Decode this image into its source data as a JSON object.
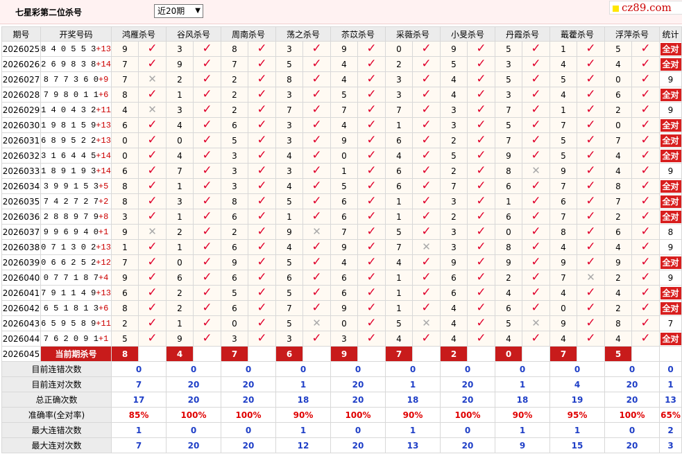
{
  "header": {
    "title": "七星彩第二位杀号",
    "period_selected": "近20期",
    "logo_text": "cz89.com"
  },
  "columns": {
    "issue": "期号",
    "draw": "开奖号码",
    "experts": [
      "鸿雁杀号",
      "谷风杀号",
      "周南杀号",
      "荡之杀号",
      "苶苡杀号",
      "采薇杀号",
      "小旻杀号",
      "丹霞杀号",
      "蕺藿杀号",
      "浮萍杀号"
    ],
    "stat": "统计"
  },
  "rows": [
    {
      "issue": "2026025",
      "main": "840553",
      "special": "+13",
      "kills": [
        9,
        3,
        8,
        3,
        9,
        0,
        9,
        5,
        1,
        5
      ],
      "results": [
        1,
        1,
        1,
        1,
        1,
        1,
        1,
        1,
        1,
        1
      ],
      "stat": "全对"
    },
    {
      "issue": "2026026",
      "main": "269838",
      "special": "+14",
      "kills": [
        7,
        9,
        7,
        5,
        4,
        2,
        5,
        3,
        4,
        4
      ],
      "results": [
        1,
        1,
        1,
        1,
        1,
        1,
        1,
        1,
        1,
        1
      ],
      "stat": "全对"
    },
    {
      "issue": "2026027",
      "main": "877360",
      "special": "+9",
      "kills": [
        7,
        2,
        2,
        8,
        4,
        3,
        4,
        5,
        5,
        0
      ],
      "results": [
        0,
        1,
        1,
        1,
        1,
        1,
        1,
        1,
        1,
        1
      ],
      "stat": "9"
    },
    {
      "issue": "2026028",
      "main": "798011",
      "special": "+6",
      "kills": [
        8,
        1,
        2,
        3,
        5,
        3,
        4,
        3,
        4,
        6
      ],
      "results": [
        1,
        1,
        1,
        1,
        1,
        1,
        1,
        1,
        1,
        1
      ],
      "stat": "全对"
    },
    {
      "issue": "2026029",
      "main": "140432",
      "special": "+11",
      "kills": [
        4,
        3,
        2,
        7,
        7,
        7,
        3,
        7,
        1,
        2
      ],
      "results": [
        0,
        1,
        1,
        1,
        1,
        1,
        1,
        1,
        1,
        1
      ],
      "stat": "9"
    },
    {
      "issue": "2026030",
      "main": "198159",
      "special": "+13",
      "kills": [
        6,
        4,
        6,
        3,
        4,
        1,
        3,
        5,
        7,
        0
      ],
      "results": [
        1,
        1,
        1,
        1,
        1,
        1,
        1,
        1,
        1,
        1
      ],
      "stat": "全对"
    },
    {
      "issue": "2026031",
      "main": "689522",
      "special": "+13",
      "kills": [
        0,
        0,
        5,
        3,
        9,
        6,
        2,
        7,
        5,
        7
      ],
      "results": [
        1,
        1,
        1,
        1,
        1,
        1,
        1,
        1,
        1,
        1
      ],
      "stat": "全对"
    },
    {
      "issue": "2026032",
      "main": "316445",
      "special": "+14",
      "kills": [
        0,
        4,
        3,
        4,
        0,
        4,
        5,
        9,
        5,
        4
      ],
      "results": [
        1,
        1,
        1,
        1,
        1,
        1,
        1,
        1,
        1,
        1
      ],
      "stat": "全对"
    },
    {
      "issue": "2026033",
      "main": "189193",
      "special": "+14",
      "kills": [
        6,
        7,
        3,
        3,
        1,
        6,
        2,
        8,
        9,
        4
      ],
      "results": [
        1,
        1,
        1,
        1,
        1,
        1,
        1,
        0,
        1,
        1
      ],
      "stat": "9"
    },
    {
      "issue": "2026034",
      "main": "399153",
      "special": "+5",
      "kills": [
        8,
        1,
        3,
        4,
        5,
        6,
        7,
        6,
        7,
        8
      ],
      "results": [
        1,
        1,
        1,
        1,
        1,
        1,
        1,
        1,
        1,
        1
      ],
      "stat": "全对"
    },
    {
      "issue": "2026035",
      "main": "742727",
      "special": "+2",
      "kills": [
        8,
        3,
        8,
        5,
        6,
        1,
        3,
        1,
        6,
        7
      ],
      "results": [
        1,
        1,
        1,
        1,
        1,
        1,
        1,
        1,
        1,
        1
      ],
      "stat": "全对"
    },
    {
      "issue": "2026036",
      "main": "288979",
      "special": "+8",
      "kills": [
        3,
        1,
        6,
        1,
        6,
        1,
        2,
        6,
        7,
        2
      ],
      "results": [
        1,
        1,
        1,
        1,
        1,
        1,
        1,
        1,
        1,
        1
      ],
      "stat": "全对"
    },
    {
      "issue": "2026037",
      "main": "996940",
      "special": "+1",
      "kills": [
        9,
        2,
        2,
        9,
        7,
        5,
        3,
        0,
        8,
        6
      ],
      "results": [
        0,
        1,
        1,
        0,
        1,
        1,
        1,
        1,
        1,
        1
      ],
      "stat": "8"
    },
    {
      "issue": "2026038",
      "main": "071302",
      "special": "+13",
      "kills": [
        1,
        1,
        6,
        4,
        9,
        7,
        3,
        8,
        4,
        4
      ],
      "results": [
        1,
        1,
        1,
        1,
        1,
        0,
        1,
        1,
        1,
        1
      ],
      "stat": "9"
    },
    {
      "issue": "2026039",
      "main": "066252",
      "special": "+12",
      "kills": [
        7,
        0,
        9,
        5,
        4,
        4,
        9,
        9,
        9,
        9
      ],
      "results": [
        1,
        1,
        1,
        1,
        1,
        1,
        1,
        1,
        1,
        1
      ],
      "stat": "全对"
    },
    {
      "issue": "2026040",
      "main": "077187",
      "special": "+4",
      "kills": [
        9,
        6,
        6,
        6,
        6,
        1,
        6,
        2,
        7,
        2
      ],
      "results": [
        1,
        1,
        1,
        1,
        1,
        1,
        1,
        1,
        0,
        1
      ],
      "stat": "9"
    },
    {
      "issue": "2026041",
      "main": "791149",
      "special": "+13",
      "kills": [
        6,
        2,
        5,
        5,
        6,
        1,
        6,
        4,
        4,
        4
      ],
      "results": [
        1,
        1,
        1,
        1,
        1,
        1,
        1,
        1,
        1,
        1
      ],
      "stat": "全对"
    },
    {
      "issue": "2026042",
      "main": "651813",
      "special": "+6",
      "kills": [
        8,
        2,
        6,
        7,
        9,
        1,
        4,
        6,
        0,
        2
      ],
      "results": [
        1,
        1,
        1,
        1,
        1,
        1,
        1,
        1,
        1,
        1
      ],
      "stat": "全对"
    },
    {
      "issue": "2026043",
      "main": "659589",
      "special": "+11",
      "kills": [
        2,
        1,
        0,
        5,
        0,
        5,
        4,
        5,
        9,
        8
      ],
      "results": [
        1,
        1,
        1,
        0,
        1,
        0,
        1,
        0,
        1,
        1
      ],
      "stat": "7"
    },
    {
      "issue": "2026044",
      "main": "762091",
      "special": "+1",
      "kills": [
        5,
        9,
        3,
        3,
        3,
        4,
        4,
        4,
        4,
        4
      ],
      "results": [
        1,
        1,
        1,
        1,
        1,
        1,
        1,
        1,
        1,
        1
      ],
      "stat": "全对"
    }
  ],
  "current": {
    "issue": "2026045",
    "label": "当前期杀号",
    "kills": [
      8,
      4,
      7,
      6,
      9,
      7,
      2,
      0,
      7,
      5
    ]
  },
  "stats": [
    {
      "label": "目前连错次数",
      "values": [
        "0",
        "0",
        "0",
        "0",
        "0",
        "0",
        "0",
        "0",
        "0",
        "0"
      ],
      "total": "0",
      "red": false
    },
    {
      "label": "目前连对次数",
      "values": [
        "7",
        "20",
        "20",
        "1",
        "20",
        "1",
        "20",
        "1",
        "4",
        "20"
      ],
      "total": "1",
      "red": false
    },
    {
      "label": "总正确次数",
      "values": [
        "17",
        "20",
        "20",
        "18",
        "20",
        "18",
        "20",
        "18",
        "19",
        "20"
      ],
      "total": "13",
      "red": false
    },
    {
      "label": "准确率(全对率)",
      "values": [
        "85%",
        "100%",
        "100%",
        "90%",
        "100%",
        "90%",
        "100%",
        "90%",
        "95%",
        "100%"
      ],
      "total": "65%",
      "red": true
    },
    {
      "label": "最大连错次数",
      "values": [
        "1",
        "0",
        "0",
        "1",
        "0",
        "1",
        "0",
        "1",
        "1",
        "0"
      ],
      "total": "2",
      "red": false
    },
    {
      "label": "最大连对次数",
      "values": [
        "7",
        "20",
        "20",
        "12",
        "20",
        "13",
        "20",
        "9",
        "15",
        "20"
      ],
      "total": "3",
      "red": false
    }
  ],
  "icons": {
    "correct": "check-icon",
    "wrong": "cross-icon"
  },
  "colors": {
    "accent_red": "#c81b1b",
    "stat_blue": "#1f3fc7",
    "header_bg": "#fff2f2"
  }
}
